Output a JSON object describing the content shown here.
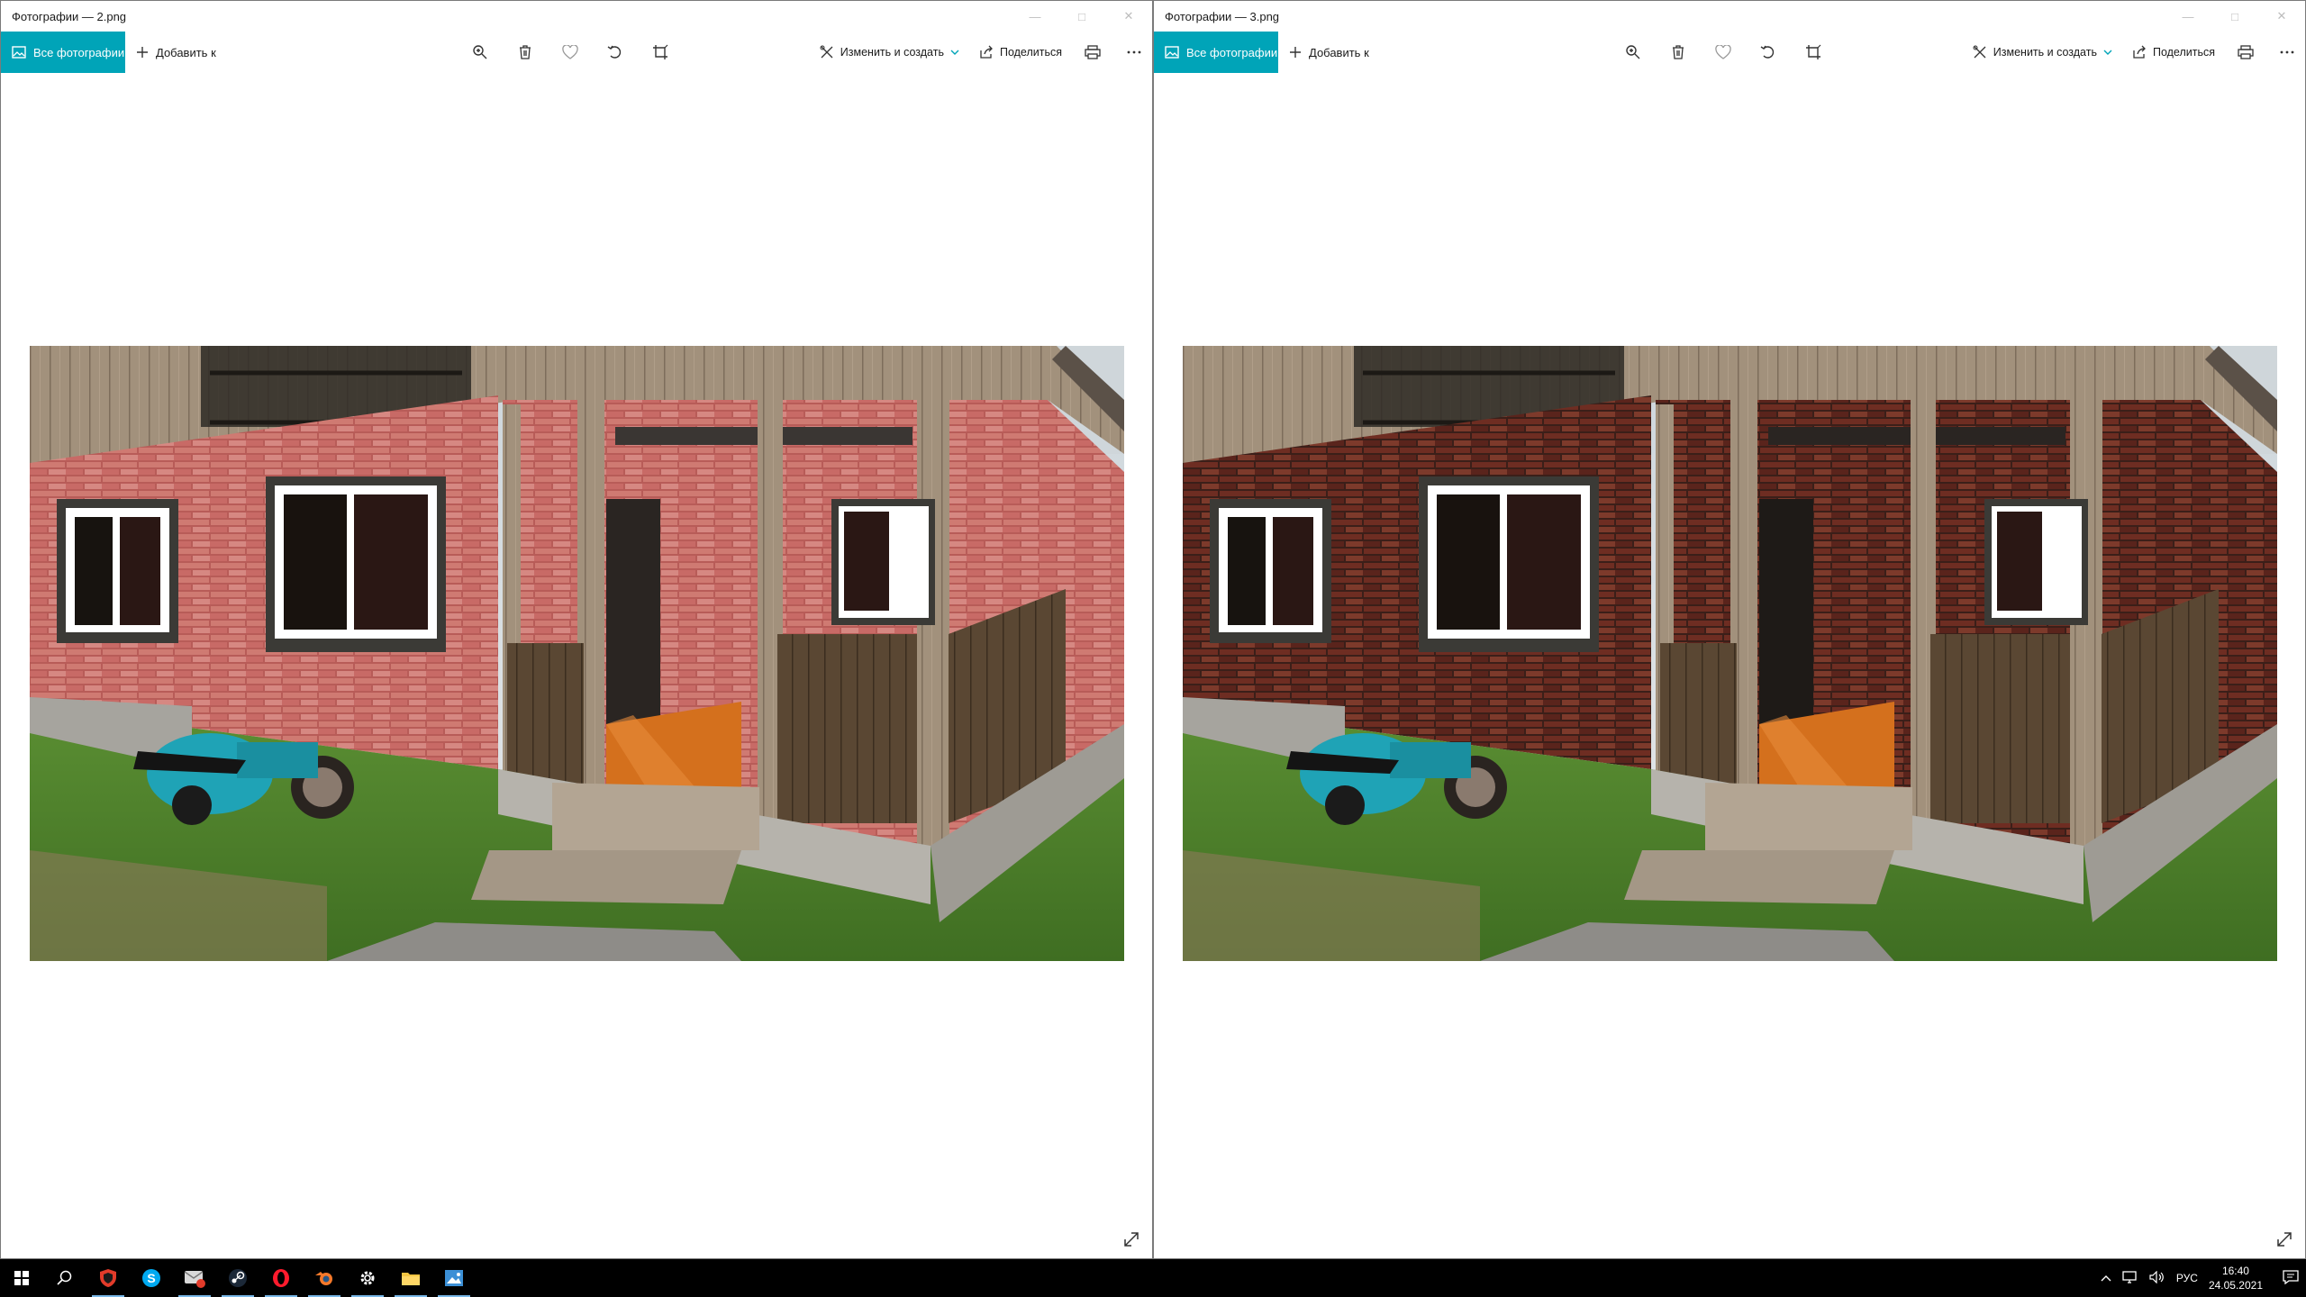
{
  "windows": [
    {
      "title": "Фотографии — 2.png",
      "toolbar": {
        "all_photos": "Все фотографии",
        "add_to": "Добавить к",
        "edit_create": "Изменить и создать",
        "share": "Поделиться"
      },
      "brick_style": "light"
    },
    {
      "title": "Фотографии — 3.png",
      "toolbar": {
        "all_photos": "Все фотографии",
        "add_to": "Добавить к",
        "edit_create": "Изменить и создать",
        "share": "Поделиться"
      },
      "brick_style": "dark"
    }
  ],
  "colors": {
    "accent": "#00a4b8",
    "taskbar": "#000000",
    "brick_light": "#c7645f",
    "brick_dark": "#6b2b22",
    "wood": "#9c8a74",
    "grass": "#4f8a2e",
    "floor": "#d9741e",
    "moto": "#1fa3b6"
  },
  "taskbar": {
    "icons": [
      "windows-start-icon",
      "search-icon",
      "shield-app-icon",
      "skype-icon",
      "mail-app-icon",
      "steam-icon",
      "opera-icon",
      "blender-icon",
      "settings-gear-icon",
      "file-explorer-icon",
      "photos-app-icon"
    ],
    "language": "РУС",
    "time": "16:40",
    "date": "24.05.2021"
  }
}
